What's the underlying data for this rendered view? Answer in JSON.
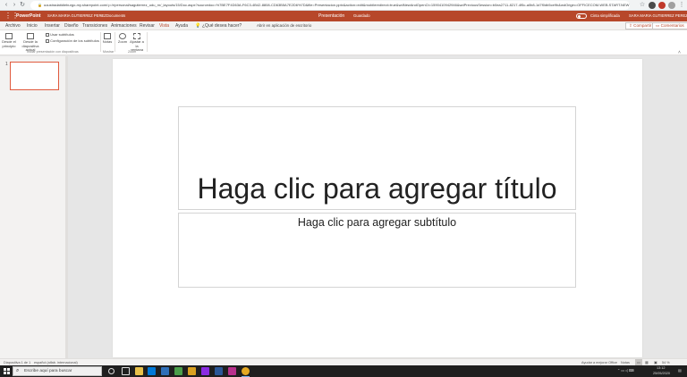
{
  "browser": {
    "url": "uoustradatidieburgo-my.sharepoint.com/:p:/r/personal/sagutierrez_udu_rn/_layouts/15/Doc.aspx?sourcedoc=%7BE7F4D63A-F6C3-4B42-8808-CD63B5A7E2D6%7D&file=Presentacion.pptx&action=edit&mobileredirect=true&wdNewAndOpenCt=1590410942946&wdPreviousSession=b0ea2711-8217-4f5c-a0b8-1d7f0db5ce9b&wdOrigin=OFFICECOM-WEB.START.NEW"
  },
  "header": {
    "app_name": "PowerPoint",
    "user_breadcrumb": "SARA MARIA GUTIERREZ PEREZ",
    "separator": "›",
    "location": "Documents",
    "doc_title": "Presentación",
    "save_status": "Guardado",
    "simplified_ribbon_label": "Cinta simplificada",
    "user_name": "SARA MARIA GUTIERREZ PEREZ"
  },
  "menu": {
    "tabs": [
      "Archivo",
      "Inicio",
      "Insertar",
      "Diseño",
      "Transiciones",
      "Animaciones",
      "Revisar",
      "Vista",
      "Ayuda"
    ],
    "active_tab": "Vista",
    "tell_me": "¿Qué desea hacer?",
    "open_desktop": "Abrir en aplicación de escritorio",
    "share_label": "Compartir",
    "comments_label": "Comentarios"
  },
  "ribbon": {
    "btn_from_start": "Desde el principio",
    "btn_from_current": "Desde la diapositiva actual",
    "chk_subtitles": "Usar subtítulos",
    "btn_subtitle_settings": "Configuración de los subtítulos",
    "group_present": "Iniciar presentación con diapositivas",
    "btn_notes": "Notas",
    "group_show": "Mostrar",
    "btn_zoom": "Zoom",
    "btn_fit": "Ajustar a la ventana",
    "group_zoom": "Zoom"
  },
  "thumbnails": {
    "slide_number": "1"
  },
  "slide": {
    "title_placeholder": "Haga clic para agregar título",
    "subtitle_placeholder": "Haga clic para agregar subtítulo"
  },
  "status": {
    "slide_count": "Diapositiva 1 de 1",
    "language": "español (alfab. internacional)",
    "help_improve": "Ayudar a mejorar Office",
    "notes_label": "Notas",
    "zoom_level": "54 %"
  },
  "taskbar": {
    "search_placeholder": "Escribe aquí para buscar",
    "time": "13:12",
    "date": "25/05/2020"
  },
  "colors": {
    "brand": "#b7472a",
    "taskbar": "#1f1f1f"
  }
}
